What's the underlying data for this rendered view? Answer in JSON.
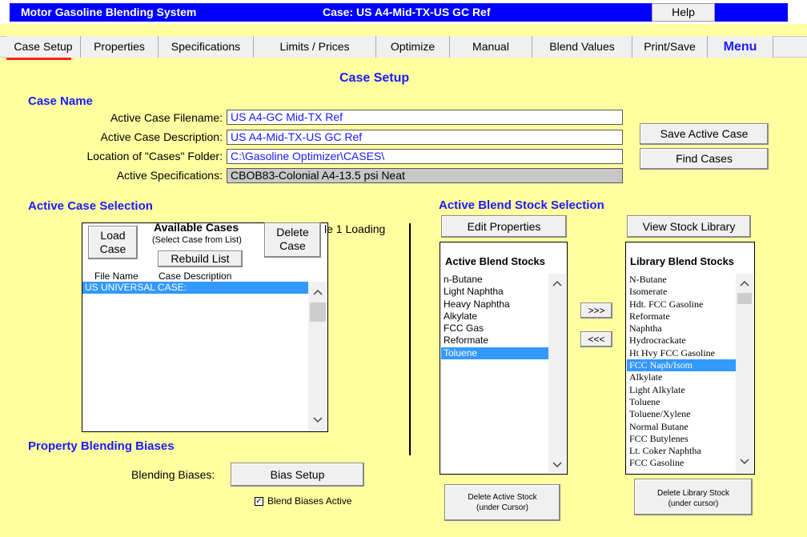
{
  "titlebar": {
    "app_title": "Motor Gasoline Blending System",
    "case_title": "Case: US A4-Mid-TX-US GC Ref",
    "help_label": "Help"
  },
  "menu": {
    "tabs": [
      "Case Setup",
      "Properties",
      "Specifications",
      "Limits / Prices",
      "Optimize",
      "Manual",
      "Blend Values",
      "Print/Save"
    ],
    "menu_label": "Menu"
  },
  "page": {
    "title": "Case Setup"
  },
  "case_name": {
    "heading": "Case Name",
    "filename_label": "Active Case Filename:",
    "filename_value": "US A4-GC Mid-TX Ref",
    "description_label": "Active Case Description:",
    "description_value": "US A4-Mid-TX-US GC Ref",
    "folder_label": "Location of \"Cases\" Folder:",
    "folder_value": "C:\\Gasoline Optimizer\\CASES\\",
    "specs_label": "Active Specifications:",
    "specs_value": "CBOB83-Colonial A4-13.5 psi Neat",
    "save_button": "Save Active Case",
    "find_button": "Find Cases"
  },
  "case_selection": {
    "heading": "Active Case Selection",
    "load_button": "Load Case",
    "available_title": "Available Cases",
    "available_hint": "(Select Case from List)",
    "rebuild_button": "Rebuild List",
    "delete_button": "Delete Case",
    "col_file": "File Name",
    "col_desc": "Case Description",
    "items": [
      "US UNIVERSAL CASE:"
    ],
    "overlay_text": "le 1 Loading"
  },
  "biases": {
    "heading": "Property Blending Biases",
    "label": "Blending Biases:",
    "button": "Bias Setup",
    "checkbox_label": "Blend Biases  Active",
    "checked": true
  },
  "blend_stock": {
    "heading": "Active Blend Stock Selection",
    "edit_button": "Edit Properties",
    "view_library_button": "View Stock Library",
    "active_title": "Active Blend Stocks",
    "active_items": [
      "n-Butane",
      "Light Naphtha",
      "Heavy Naphtha",
      "Alkylate",
      "FCC Gas",
      "Reformate",
      "Toluene"
    ],
    "active_selected": "Toluene",
    "library_title": "Library Blend Stocks",
    "library_items": [
      "N-Butane",
      "Isomerate",
      "Hdt. FCC Gasoline",
      "Reformate",
      "Naphtha",
      "Hydrocrackate",
      "Ht Hvy FCC Gasoline",
      "FCC Naph/Isom",
      "Alkylate",
      "Light Alkylate",
      "Toluene",
      "Toluene/Xylene",
      "Normal Butane",
      "FCC Butylenes",
      "Lt. Coker Naphtha",
      "FCC Gasoline"
    ],
    "library_selected": "FCC Naph/Isom",
    "add_button": ">>>",
    "remove_button": "<<<",
    "delete_active_button_line1": "Delete Active  Stock",
    "delete_active_button_line2": "(under Cursor)",
    "delete_library_button_line1": "Delete Library Stock",
    "delete_library_button_line2": "(under cursor)"
  },
  "icons": {
    "scroll_up": "chevron-up-icon",
    "scroll_down": "chevron-down-icon",
    "checkbox": "checkbox-icon"
  }
}
